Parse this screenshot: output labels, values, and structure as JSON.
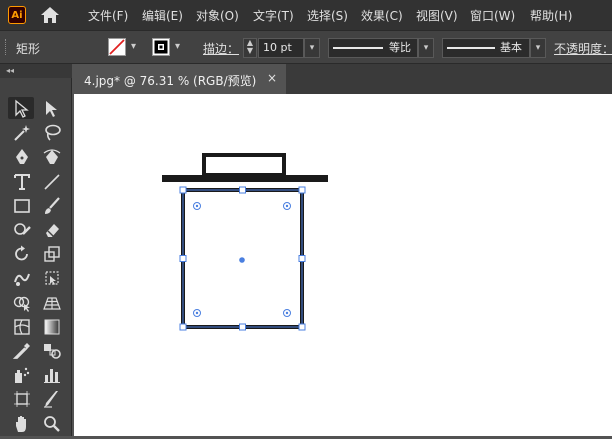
{
  "app": {
    "logo": "Ai"
  },
  "menu": [
    "文件(F)",
    "编辑(E)",
    "对象(O)",
    "文字(T)",
    "选择(S)",
    "效果(C)",
    "视图(V)",
    "窗口(W)",
    "帮助(H)"
  ],
  "control": {
    "selection_label": "矩形",
    "stroke_label": "描边：",
    "stroke_value": "10 pt",
    "profile_label": "等比",
    "brush_label": "基本",
    "opacity_label": "不透明度："
  },
  "document": {
    "tab_title": "4.jpg* @ 76.31 % (RGB/预览)",
    "close": "×"
  },
  "toolbar": {
    "collapse_glyph": "◂◂",
    "tools": [
      {
        "name": "selection-tool-icon",
        "selected": true
      },
      {
        "name": "direct-selection-tool-icon"
      },
      {
        "name": "magic-wand-tool-icon"
      },
      {
        "name": "lasso-tool-icon"
      },
      {
        "name": "pen-tool-icon"
      },
      {
        "name": "curvature-tool-icon"
      },
      {
        "name": "type-tool-icon"
      },
      {
        "name": "line-segment-tool-icon"
      },
      {
        "name": "rectangle-tool-icon"
      },
      {
        "name": "paintbrush-tool-icon"
      },
      {
        "name": "shaper-tool-icon"
      },
      {
        "name": "eraser-tool-icon"
      },
      {
        "name": "rotate-tool-icon"
      },
      {
        "name": "scale-tool-icon"
      },
      {
        "name": "warp-tool-icon"
      },
      {
        "name": "free-transform-tool-icon"
      },
      {
        "name": "shape-builder-tool-icon"
      },
      {
        "name": "perspective-grid-tool-icon"
      },
      {
        "name": "mesh-tool-icon"
      },
      {
        "name": "gradient-tool-icon"
      },
      {
        "name": "eyedropper-tool-icon"
      },
      {
        "name": "blend-tool-icon"
      },
      {
        "name": "symbol-sprayer-tool-icon"
      },
      {
        "name": "column-graph-tool-icon"
      },
      {
        "name": "artboard-tool-icon"
      },
      {
        "name": "slice-tool-icon"
      },
      {
        "name": "hand-tool-icon"
      },
      {
        "name": "zoom-tool-icon"
      }
    ]
  },
  "colors": {
    "selection": "#4a7fe0",
    "artwork": "#1a1a1a",
    "accent": "#ff9a00"
  }
}
